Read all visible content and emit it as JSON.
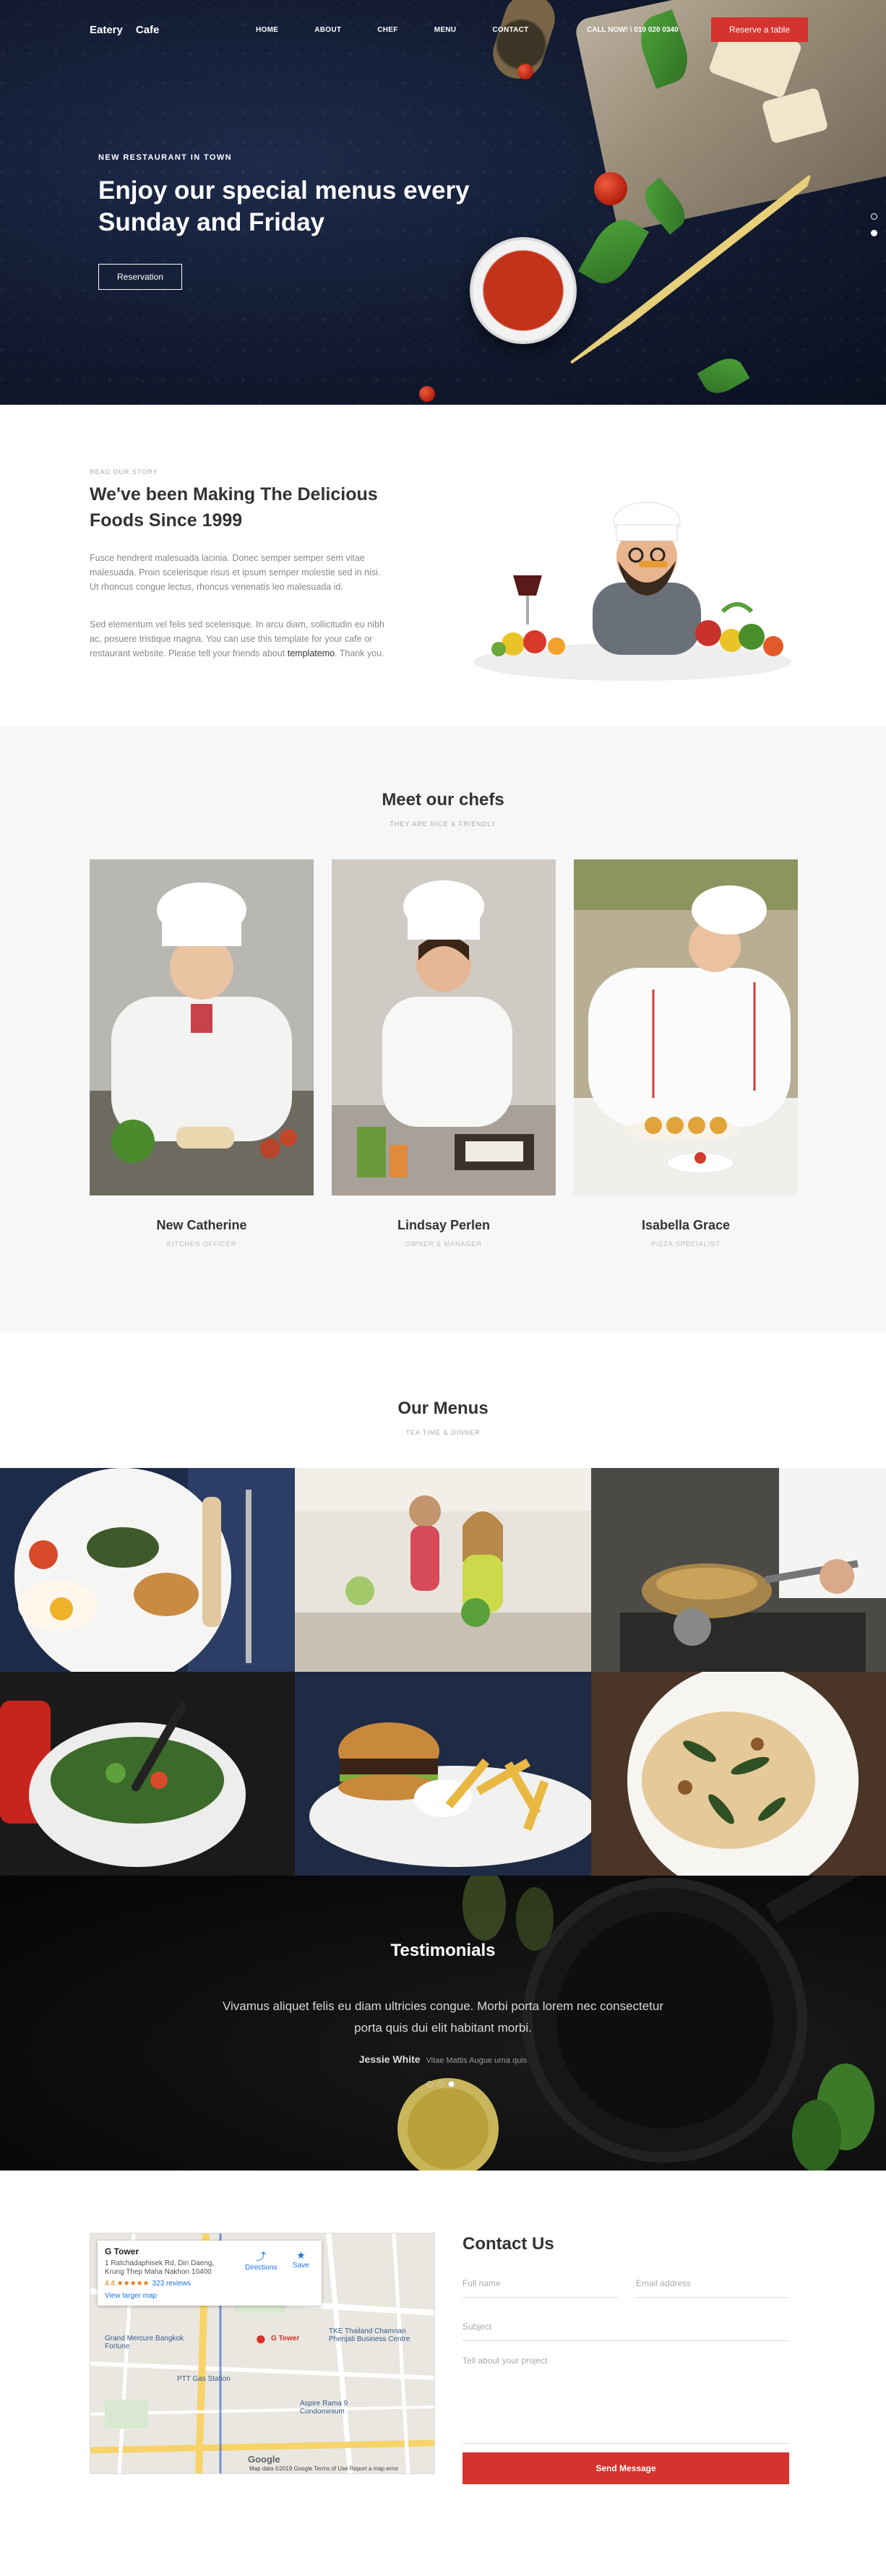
{
  "nav": {
    "brand_part1": "Eatery",
    "brand_part2": "Cafe",
    "items": [
      "HOME",
      "ABOUT",
      "CHEF",
      "MENU",
      "CONTACT"
    ],
    "call": "CALL NOW! \\ 010 020 0340",
    "reserve": "Reserve a table"
  },
  "hero": {
    "subtitle": "NEW RESTAURANT IN TOWN",
    "title": "Enjoy our special menus every Sunday and Friday",
    "button": "Reservation"
  },
  "story": {
    "eyebrow": "READ OUR STORY",
    "title": "We've been Making The Delicious Foods Since 1999",
    "p1": "Fusce hendrerit malesuada lacinia. Donec semper semper sem vitae malesuada. Proin scelerisque risus et ipsum semper molestie sed in nisi. Ut rhoncus congue lectus, rhoncus venenatis leo malesuada id.",
    "p2_a": "Sed elementum vel felis sed scelerisque. In arcu diam, sollicitudin eu nibh ac, posuere tristique magna. You can use this template for your cafe or restaurant website. Please tell your friends about ",
    "p2_link": "templatemo",
    "p2_b": ". Thank you."
  },
  "chefs": {
    "title": "Meet our chefs",
    "subtitle": "THEY ARE NICE & FRIENDLY",
    "list": [
      {
        "name": "New Catherine",
        "role": "KITCHEN OFFICER"
      },
      {
        "name": "Lindsay Perlen",
        "role": "OWNER & MANAGER"
      },
      {
        "name": "Isabella Grace",
        "role": "PIZZA SPECIALIST"
      }
    ]
  },
  "menus": {
    "title": "Our Menus",
    "subtitle": "TEA TIME & DINNER"
  },
  "testimonials": {
    "title": "Testimonials",
    "quote": "Vivamus aliquet felis eu diam ultricies congue. Morbi porta lorem nec consectetur porta quis dui elit habitant morbi.",
    "name": "Jessie White",
    "role": "Vitae Mattis Augue urna quis"
  },
  "contact": {
    "title": "Contact Us",
    "name_ph": "Full name",
    "email_ph": "Email address",
    "subject_ph": "Subject",
    "message_ph": "Tell about your project",
    "send": "Send Message"
  },
  "map": {
    "place": "G Tower",
    "address": "1 Ratchadaphisek Rd, Din Daeng, Krung Thep Maha Nakhon 10400",
    "rating": "4.4 ★★★★★",
    "reviews": "323 reviews",
    "larger": "View larger map",
    "directions": "Directions",
    "save": "Save",
    "pin_label": "G Tower",
    "labels": [
      "Grand Mercure Bangkok Fortune",
      "PTT Gas Station",
      "TKE Thailand Chamnan Phenjati Business Centre",
      "Aspire Rama 9 Condominium"
    ],
    "google": "Google",
    "footer": "Map data ©2019 Google   Terms of Use   Report a map error"
  },
  "colors": {
    "accent": "#d4332f",
    "hero_bg": "#121a30"
  },
  "icons": [
    "phone-icon",
    "directions-icon",
    "star-icon",
    "map-pin-icon"
  ]
}
